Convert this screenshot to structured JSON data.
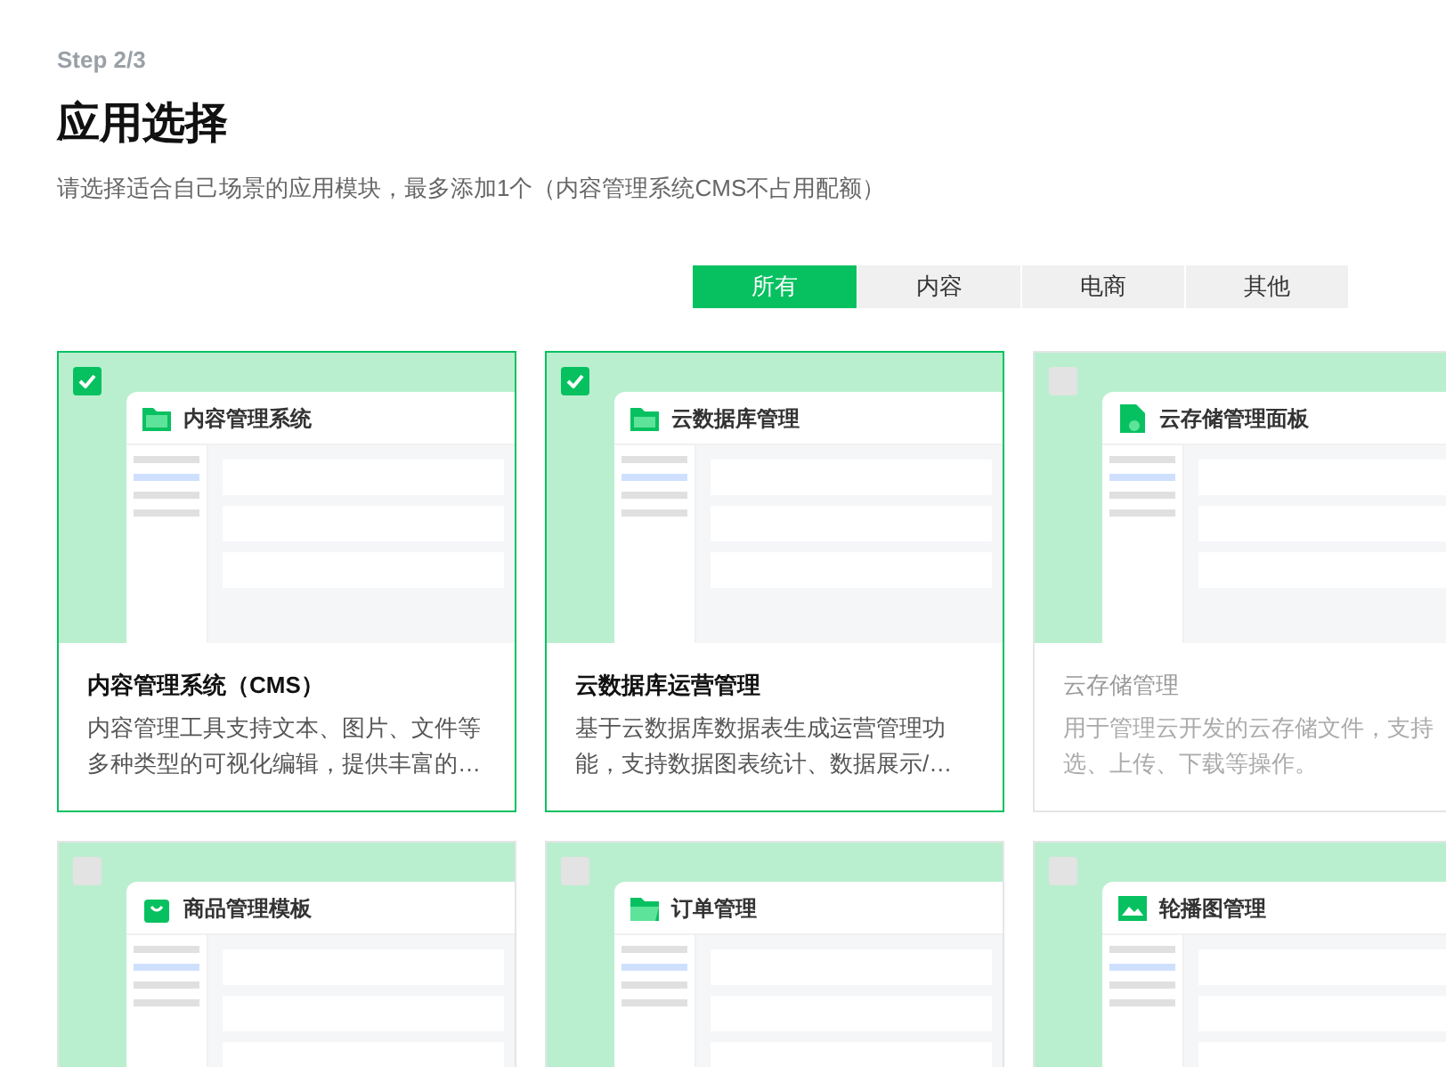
{
  "step": "Step 2/3",
  "title": "应用选择",
  "subtitle": "请选择适合自己场景的应用模块，最多添加1个（内容管理系统CMS不占用配额）",
  "tabs": [
    {
      "label": "所有",
      "selected": true
    },
    {
      "label": "内容",
      "selected": false
    },
    {
      "label": "电商",
      "selected": false
    },
    {
      "label": "其他",
      "selected": false
    }
  ],
  "apps": [
    {
      "preview_title": "内容管理系统",
      "name": "内容管理系统（CMS）",
      "description": [
        "内容管理工具支持文本、图片、文件等",
        "多种类型的可视化编辑，提供丰富的…"
      ],
      "checked": true,
      "disabled": false
    },
    {
      "preview_title": "云数据库管理",
      "name": "云数据库运营管理",
      "description": [
        "基于云数据库数据表生成运营管理功",
        "能，支持数据图表统计、数据展示/…"
      ],
      "checked": true,
      "disabled": false
    },
    {
      "preview_title": "云存储管理面板",
      "name": "云存储管理",
      "description": [
        "用于管理云开发的云存储文件，支持",
        "选、上传、下载等操作。"
      ],
      "checked": false,
      "disabled": true
    },
    {
      "preview_title": "商品管理模板",
      "checked": false,
      "disabled": false
    },
    {
      "preview_title": "订单管理",
      "checked": false,
      "disabled": false
    },
    {
      "preview_title": "轮播图管理",
      "checked": false,
      "disabled": false
    }
  ]
}
